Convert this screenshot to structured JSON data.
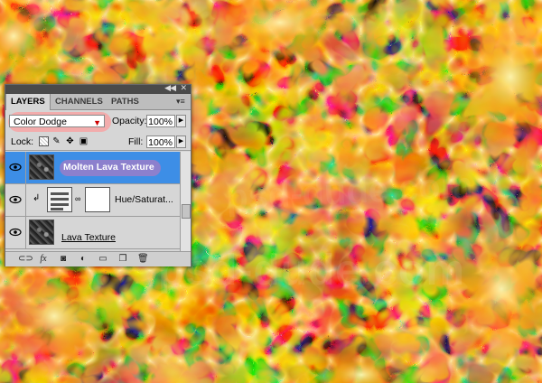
{
  "background": {
    "name": "molten lava texture canvas"
  },
  "watermark": {
    "text": "psd-dude.com"
  },
  "layers_panel": {
    "tabs": [
      {
        "label": "LAYERS",
        "active": true
      },
      {
        "label": "CHANNELS",
        "active": false
      },
      {
        "label": "PATHS",
        "active": false
      }
    ],
    "blend_mode": "Color Dodge",
    "opacity_label": "Opacity:",
    "opacity_value": "100%",
    "lock_label": "Lock:",
    "fill_label": "Fill:",
    "fill_value": "100%",
    "layers": [
      {
        "name": "Molten Lava Texture",
        "selected": true,
        "visible": true
      },
      {
        "name": "Hue/Saturat...",
        "selected": false,
        "visible": true,
        "type": "adjustment",
        "clipped": true
      },
      {
        "name": "Lava Texture",
        "selected": false,
        "visible": true
      }
    ],
    "highlight_colors": {
      "blend": "#f5a7a7",
      "layer_name": "#9a7ec8",
      "selection": "#3d8ee6"
    }
  }
}
